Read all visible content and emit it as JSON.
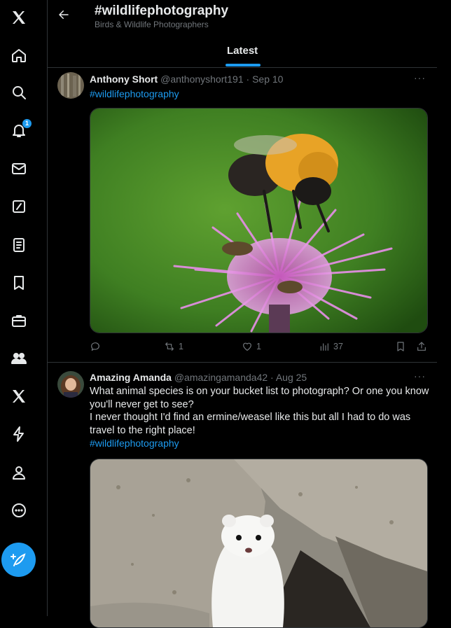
{
  "header": {
    "title": "#wildlifephotography",
    "subtitle": "Birds & Wildlife Photographers",
    "tab_latest": "Latest"
  },
  "sidebar": {
    "notification_badge": "1",
    "items": [
      {
        "icon": "x-logo-icon"
      },
      {
        "icon": "home-icon"
      },
      {
        "icon": "search-icon"
      },
      {
        "icon": "bell-icon"
      },
      {
        "icon": "mail-icon"
      },
      {
        "icon": "grok-icon"
      },
      {
        "icon": "lists-icon"
      },
      {
        "icon": "bookmark-icon"
      },
      {
        "icon": "jobs-icon"
      },
      {
        "icon": "communities-icon"
      },
      {
        "icon": "premium-icon"
      },
      {
        "icon": "verified-orgs-icon"
      },
      {
        "icon": "profile-icon"
      },
      {
        "icon": "more-icon"
      },
      {
        "icon": "compose-post-icon"
      }
    ]
  },
  "tweets": [
    {
      "name": "Anthony Short",
      "handle": "@anthonyshort191",
      "dot": "·",
      "date": "Sep 10",
      "more": "···",
      "text_lines": [],
      "hashtag": "#wildlifephotography",
      "media_subject": "bumblebee on pink thistle flower",
      "actions": {
        "replies": "",
        "reposts": "1",
        "likes": "1",
        "views": "37"
      }
    },
    {
      "name": "Amazing Amanda",
      "handle": "@amazingamanda42",
      "dot": "·",
      "date": "Aug 25",
      "more": "···",
      "text_lines": [
        "What animal species is on your bucket list to photograph? Or one you know",
        "you'll never get to see?",
        "I never thought I'd find an ermine/weasel like this but all I had to do was",
        "travel to the right place!"
      ],
      "hashtag": "#wildlifephotography",
      "media_subject": "white ermine among rocks"
    }
  ],
  "colors": {
    "accent": "#1d9bf0",
    "background": "#000000",
    "border": "#2f3336",
    "muted": "#71767b",
    "text": "#e7e9ea"
  }
}
